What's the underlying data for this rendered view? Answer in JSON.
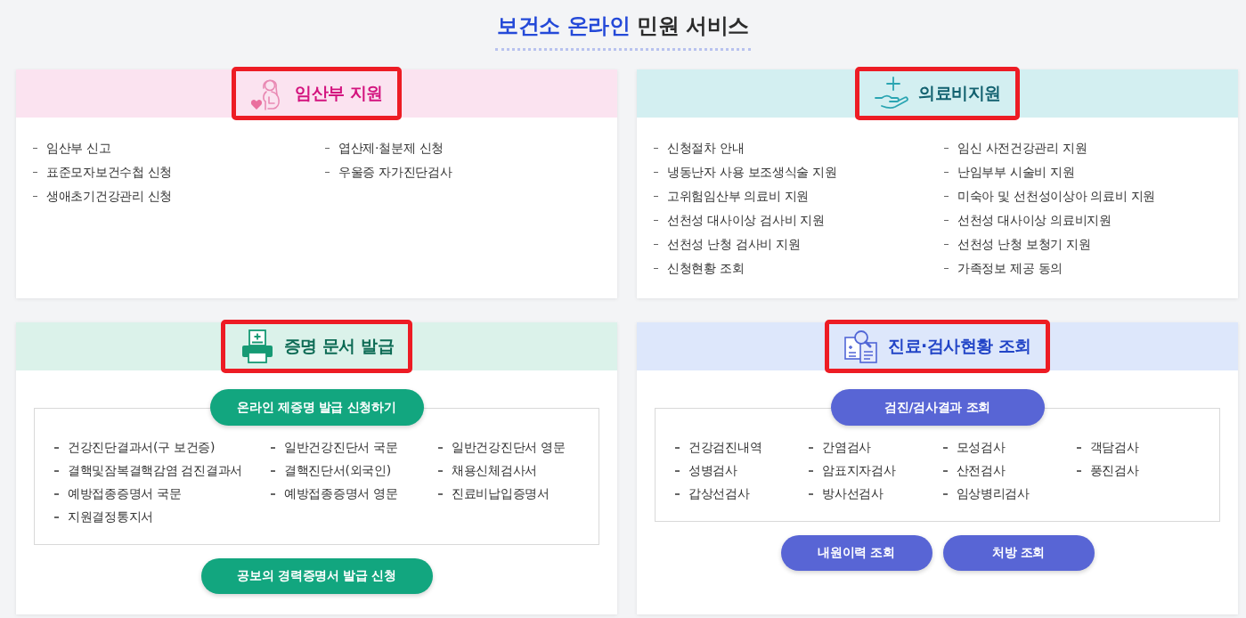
{
  "title": {
    "accent": "보건소 온라인",
    "text": "민원 서비스"
  },
  "cards": [
    {
      "title": "임산부 지원",
      "highlighted": true,
      "rows": [
        [
          "임산부 신고",
          "엽산제·철분제 신청"
        ],
        [
          "표준모자보건수첩 신청",
          "우울증 자가진단검사"
        ],
        [
          "생애초기건강관리 신청"
        ]
      ]
    },
    {
      "title": "의료비지원",
      "highlighted": true,
      "rows": [
        [
          "신청절차 안내",
          "임신 사전건강관리 지원"
        ],
        [
          "냉동난자 사용 보조생식술 지원",
          "난임부부 시술비 지원"
        ],
        [
          "고위험임산부 의료비 지원",
          "미숙아 및 선천성이상아 의료비 지원"
        ],
        [
          "선천성 대사이상 검사비 지원",
          "선천성 대사이상 의료비지원"
        ],
        [
          "선천성 난청 검사비 지원",
          "선천성 난청 보청기 지원"
        ],
        [
          "신청현황 조회",
          "가족정보 제공 동의"
        ]
      ]
    },
    {
      "title": "증명 문서 발급",
      "highlighted": true,
      "top_button": "온라인 제증명 발급 신청하기",
      "rows": [
        [
          "건강진단결과서(구 보건증)",
          "일반건강진단서 국문",
          "일반건강진단서 영문"
        ],
        [
          "결핵및잠복결핵감염 검진결과서",
          "결핵진단서(외국인)",
          "채용신체검사서"
        ],
        [
          "예방접종증명서 국문",
          "예방접종증명서 영문",
          "진료비납입증명서"
        ],
        [
          "지원결정통지서"
        ]
      ],
      "buttons": [
        "공보의 경력증명서 발급 신청"
      ]
    },
    {
      "title": "진료·검사현황 조회",
      "highlighted": true,
      "top_button": "검진/검사결과 조회",
      "rows": [
        [
          "건강검진내역",
          "간염검사",
          "모성검사",
          "객담검사"
        ],
        [
          "성병검사",
          "암표지자검사",
          "산전검사",
          "풍진검사"
        ],
        [
          "갑상선검사",
          "방사선검사",
          "임상병리검사"
        ]
      ],
      "buttons": [
        "내원이력 조회",
        "처방 조회"
      ]
    }
  ]
}
